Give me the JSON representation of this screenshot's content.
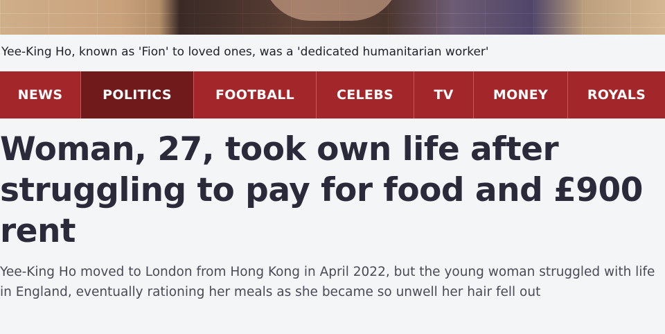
{
  "caption": "Yee-King Ho, known as 'Fion' to loved ones, was a 'dedicated humanitarian worker'",
  "nav": {
    "items": [
      {
        "label": "NEWS"
      },
      {
        "label": "POLITICS"
      },
      {
        "label": "FOOTBALL"
      },
      {
        "label": "CELEBS"
      },
      {
        "label": "TV"
      },
      {
        "label": "MONEY"
      },
      {
        "label": "ROYALS"
      }
    ],
    "active": "POLITICS",
    "bar_color": "#a3272a",
    "active_color": "#711a1c"
  },
  "article": {
    "headline": "Woman, 27, took own life after struggling to pay for food and £900 rent",
    "standfirst": "Yee-King Ho moved to London from Hong Kong in April 2022, but the young woman struggled with life in England, eventually rationing her meals as she became so unwell her hair fell out"
  }
}
